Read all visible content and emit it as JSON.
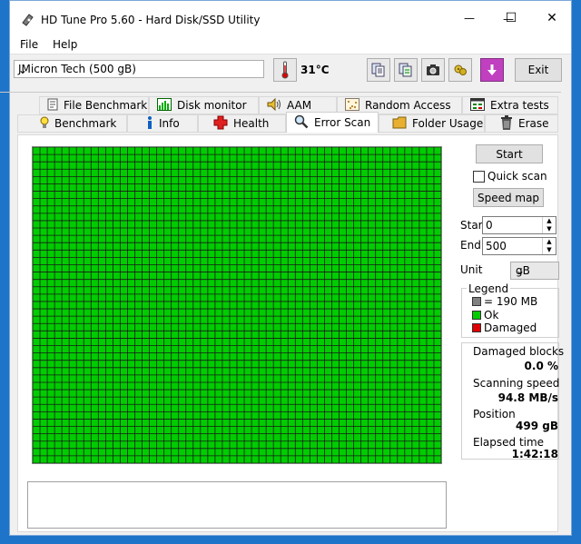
{
  "window": {
    "title": "HD Tune Pro 5.60 - Hard Disk/SSD Utility",
    "controls": {
      "minimize": "—",
      "maximize": "☐",
      "close": "✕"
    }
  },
  "menu": {
    "items": [
      "File",
      "Help"
    ]
  },
  "toolbar": {
    "drive": "JMicron Tech (500 gB)",
    "temperature": "31°C",
    "exit_label": "Exit",
    "icons": [
      "copy-icon",
      "copy-text-icon",
      "camera-icon",
      "settings-icon",
      "download-icon"
    ]
  },
  "tabs": {
    "top": [
      "File Benchmark",
      "Disk monitor",
      "AAM",
      "Random Access",
      "Extra tests"
    ],
    "bottom": [
      "Benchmark",
      "Info",
      "Health",
      "Error Scan",
      "Folder Usage",
      "Erase"
    ],
    "active": "Error Scan"
  },
  "scan": {
    "start_label": "Start",
    "quick_scan_label": "Quick scan",
    "quick_scan_checked": false,
    "speed_map_label": "Speed map",
    "start_field_label": "Start",
    "start_value": "0",
    "end_field_label": "End",
    "end_value": "500",
    "unit_label": "Unit",
    "unit_value": "gB"
  },
  "legend": {
    "title": "Legend",
    "block_size": "= 190 MB",
    "ok": "Ok",
    "damaged": "Damaged",
    "colors": {
      "block": "#808080",
      "ok": "#00cc00",
      "damaged": "#e00000"
    }
  },
  "stats": {
    "damaged_blocks_label": "Damaged blocks",
    "damaged_blocks_value": "0.0 %",
    "scanning_speed_label": "Scanning speed",
    "scanning_speed_value": "94.8 MB/s",
    "position_label": "Position",
    "position_value": "499 gB",
    "elapsed_label": "Elapsed time",
    "elapsed_value": "1:42:18"
  },
  "grid": {
    "cols": 56,
    "rows": 43,
    "cell_color": "#00cc00",
    "line_color": "#1a1a1a"
  }
}
